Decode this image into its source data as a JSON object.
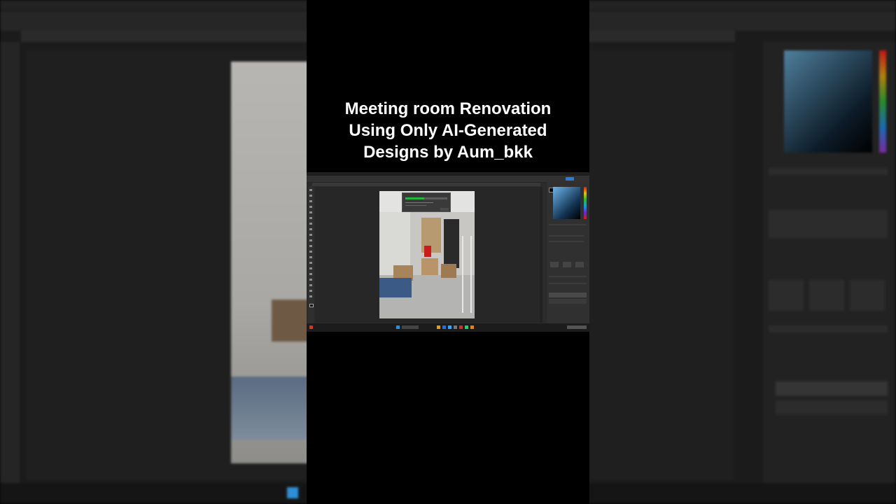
{
  "overlay": {
    "title_lines": [
      "Meeting room Renovation",
      "Using Only AI-Generated",
      "Designs by Aum_bkk"
    ]
  },
  "screenshot": {
    "app": "Photoshop",
    "progress_fraction": 0.45,
    "accent_color": "#2d7ad8",
    "progress_color": "#27b53e"
  },
  "icons": {
    "start": "windows-logo-icon",
    "weather": "weather-icon",
    "tools": "toolbar-tool-icon"
  }
}
